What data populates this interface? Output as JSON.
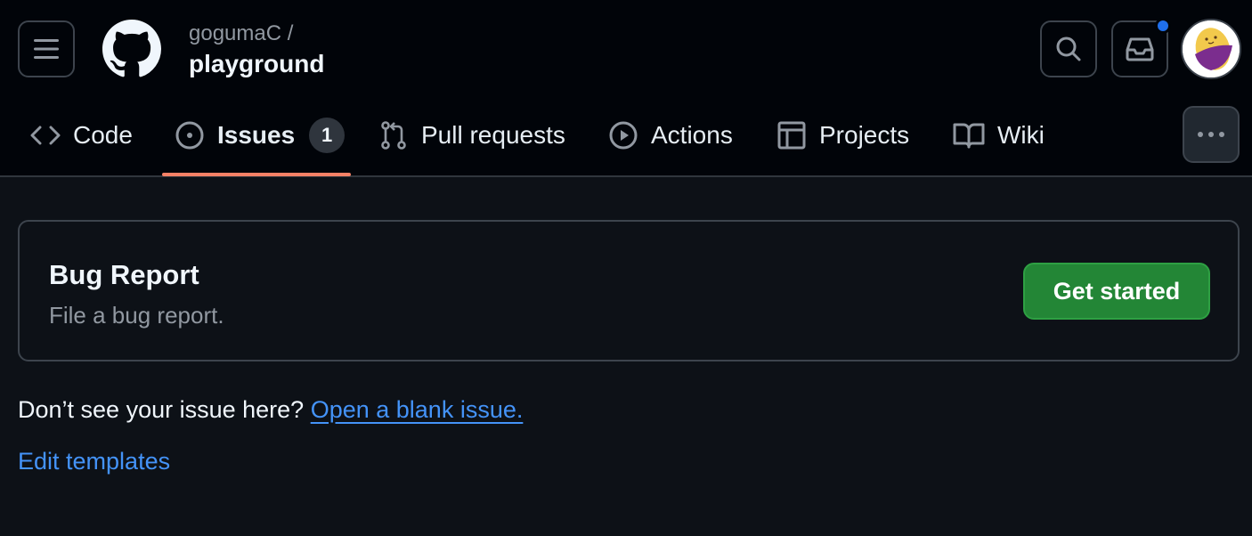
{
  "header": {
    "owner": "gogumaC /",
    "repo": "playground"
  },
  "icons": {
    "menu": "hamburger-icon",
    "logo": "github-logo-icon",
    "search": "search-icon",
    "inbox": "inbox-icon",
    "more": "kebab-horizontal-icon"
  },
  "tabs": [
    {
      "label": "Code",
      "icon": "code-icon"
    },
    {
      "label": "Issues",
      "icon": "issue-opened-icon",
      "counter": "1",
      "selected": true
    },
    {
      "label": "Pull requests",
      "icon": "git-pull-request-icon"
    },
    {
      "label": "Actions",
      "icon": "play-icon"
    },
    {
      "label": "Projects",
      "icon": "table-icon"
    },
    {
      "label": "Wiki",
      "icon": "book-icon"
    }
  ],
  "template": {
    "title": "Bug Report",
    "description": "File a bug report.",
    "button_label": "Get started"
  },
  "footer": {
    "prompt": "Don’t see your issue here?",
    "blank_issue_link": "Open a blank issue.",
    "edit_templates_link": "Edit templates"
  },
  "colors": {
    "header_bg": "#010409",
    "page_bg": "#0d1117",
    "accent_underline": "#f78166",
    "primary_button": "#238636",
    "link": "#4493f8",
    "notification_dot": "#1f6feb"
  }
}
